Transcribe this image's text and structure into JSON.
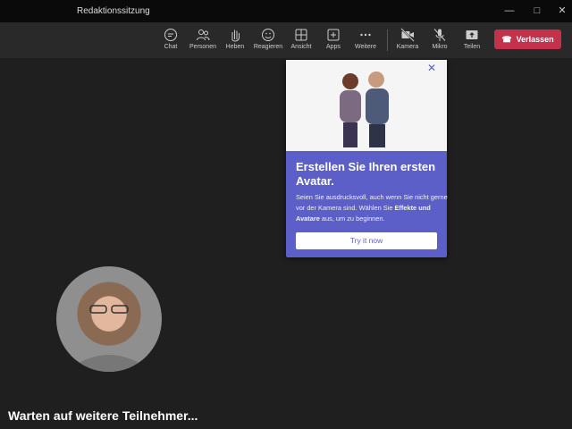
{
  "window": {
    "title": "Redaktionssitzung"
  },
  "toolbar": {
    "items": [
      {
        "label": "Chat",
        "icon": "chat-icon"
      },
      {
        "label": "Personen",
        "icon": "people-icon"
      },
      {
        "label": "Heben",
        "icon": "raise-hand-icon"
      },
      {
        "label": "Reagieren",
        "icon": "smile-icon"
      },
      {
        "label": "Ansicht",
        "icon": "grid-icon"
      },
      {
        "label": "Apps",
        "icon": "apps-icon"
      },
      {
        "label": "Weitere",
        "icon": "more-icon"
      },
      {
        "label": "Kamera",
        "icon": "camera-off-icon"
      },
      {
        "label": "Mikro",
        "icon": "mic-off-icon"
      },
      {
        "label": "Teilen",
        "icon": "share-icon"
      }
    ],
    "leave_label": "Verlassen",
    "leave_color": "#c4314b"
  },
  "popup": {
    "title": "Erstellen Sie Ihren ersten Avatar.",
    "body_pre": "Seien Sie ausdrucksvoll, auch wenn Sie nicht gerne vor der Kamera sind. Wählen Sie ",
    "body_bold": "Effekte und Avatare",
    "body_post": " aus, um zu beginnen.",
    "button": "Try it now",
    "accent": "#5b5fc7"
  },
  "stage": {
    "waiting": "Warten auf weitere Teilnehmer..."
  }
}
